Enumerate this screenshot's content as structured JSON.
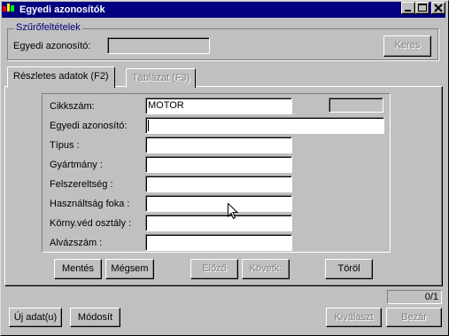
{
  "window": {
    "title": "Egyedi azonosítók"
  },
  "filter": {
    "group_title": "Szűrőfeltételek",
    "id_label": "Egyedi azonosító:",
    "id_value": "",
    "search_label": "Keres"
  },
  "tabs": [
    {
      "label": "Részletes adatok (F2)",
      "active": true
    },
    {
      "label": "Táblázat (F3)",
      "active": false
    }
  ],
  "form": {
    "fields": [
      {
        "label": "Cikkszám:",
        "value": "MOTOR"
      },
      {
        "label": "Egyedi azonosító:",
        "value": ""
      },
      {
        "label": "Típus :",
        "value": ""
      },
      {
        "label": "Gyártmány :",
        "value": ""
      },
      {
        "label": "Felszereltség :",
        "value": ""
      },
      {
        "label": "Használtság foka :",
        "value": ""
      },
      {
        "label": "Körny.véd osztály :",
        "value": ""
      },
      {
        "label": "Alvázszám :",
        "value": ""
      }
    ],
    "code_box_value": ""
  },
  "actions": {
    "save": "Mentés",
    "cancel": "Mégsem",
    "prev": "Előző",
    "next": "Követk.",
    "delete": "Töröl"
  },
  "status": {
    "record_counter": "0/1"
  },
  "footer": {
    "new_item": "Új adat(u)",
    "modify": "Módosít",
    "select": "Kiválaszt",
    "close": "Bezár"
  },
  "colors": {
    "title_bar": "#000080",
    "face": "#c0c0c0",
    "group_title": "#000080"
  }
}
